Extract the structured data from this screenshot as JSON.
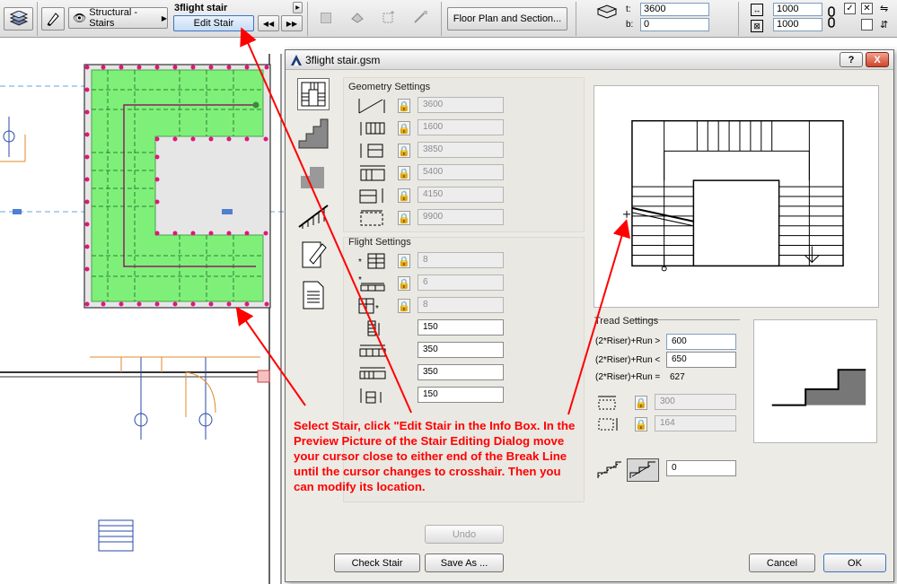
{
  "info_box": {
    "element_name": "3flight stair",
    "edit_stair_label": "Edit Stair",
    "view_mode_label": "Structural - Stairs",
    "floor_plan_button": "Floor Plan and Section...",
    "t_label": "t:",
    "t_value": "3600",
    "b_label": "b:",
    "b_value": "0",
    "dim1_value": "1000",
    "dim2_value": "1000"
  },
  "dialog": {
    "title": "3flight stair.gsm",
    "help_label": "?",
    "close_label": "X",
    "geometry_label": "Geometry Settings",
    "geometry_values": [
      "3600",
      "1600",
      "3850",
      "5400",
      "4150",
      "9900"
    ],
    "flight_label": "Flight Settings",
    "flight_locked_values": [
      "8",
      "6",
      "8"
    ],
    "flight_editable_values": [
      "150",
      "350",
      "350",
      "150"
    ],
    "tread_label": "Tread Settings",
    "tread_rules": [
      {
        "label": "(2*Riser)+Run >",
        "value": "600"
      },
      {
        "label": "(2*Riser)+Run <",
        "value": "650"
      },
      {
        "label": "(2*Riser)+Run =",
        "value": "627"
      }
    ],
    "tread_locked_values": [
      "300",
      "164"
    ],
    "nosing_value": "0",
    "undo_label": "Undo",
    "check_stair_label": "Check Stair",
    "save_as_label": "Save As ...",
    "cancel_label": "Cancel",
    "ok_label": "OK"
  },
  "annotation": "Select Stair, click \"Edit Stair in the Info Box. In the Preview Picture of the Stair Editing Dialog move your cursor close to either end of the Break Line until the cursor changes to crosshair. Then you can modify its location.",
  "colors": {
    "annotation": "#ff0000",
    "stair_fill": "#7ef07a",
    "node": "#e0167a",
    "accent": "#3c74c4"
  }
}
